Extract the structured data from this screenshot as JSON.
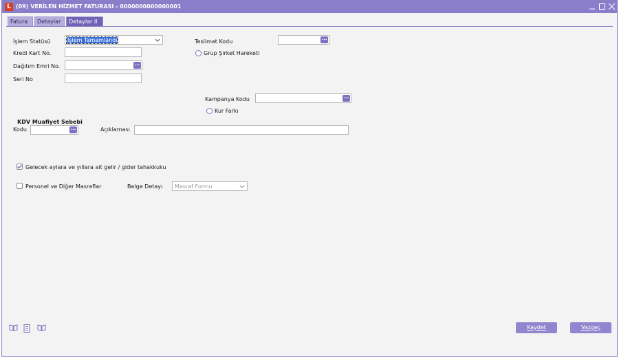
{
  "window": {
    "title": "(09) VERİLEN HİZMET FATURASI - 0000000000000001",
    "app_icon_letter": "L"
  },
  "tabs": [
    {
      "label": "Fatura",
      "active": false
    },
    {
      "label": "Detaylar",
      "active": false
    },
    {
      "label": "Detaylar II",
      "active": true
    }
  ],
  "form": {
    "islem_statusu": {
      "label": "İşlem Statüsü",
      "value": "İşlem Tamamlandı"
    },
    "kredi_karti": {
      "label": "Kredi Kart No.",
      "value": ""
    },
    "dagitim_emri": {
      "label": "Dağıtım Emri No.",
      "value": ""
    },
    "seri_no": {
      "label": "Seri No",
      "value": ""
    },
    "teslimat_kodu": {
      "label": "Teslimat Kodu",
      "value": ""
    },
    "grup_sirket": {
      "label": "Grup Şirket Hareketi",
      "checked": false
    },
    "kampanya_kodu": {
      "label": "Kampanya Kodu",
      "value": ""
    },
    "kur_farki": {
      "label": "Kur Farkı",
      "checked": false
    },
    "kdv_muafiyet": {
      "title": "KDV Muafiyet Sebebi",
      "kodu_label": "Kodu",
      "kodu_value": "",
      "aciklama_label": "Açıklaması",
      "aciklama_value": ""
    },
    "gelecek_aylar": {
      "label": "Gelecek aylara ve yıllara ait gelir / gider tahakkuku",
      "checked": true
    },
    "personel": {
      "label": "Personel ve Diğer Masraflar",
      "checked": false
    },
    "belge_detayi": {
      "label": "Belge Detayı",
      "value": "Masraf Formu"
    }
  },
  "buttons": {
    "kaydet": "Kaydet",
    "vazgec": "Vazgeç"
  },
  "lookup_glyph": "...",
  "colors": {
    "titlebar": "#8a7ecb",
    "accent": "#6f63b6",
    "button": "#8f86cf",
    "selection": "#3a6fd8"
  }
}
